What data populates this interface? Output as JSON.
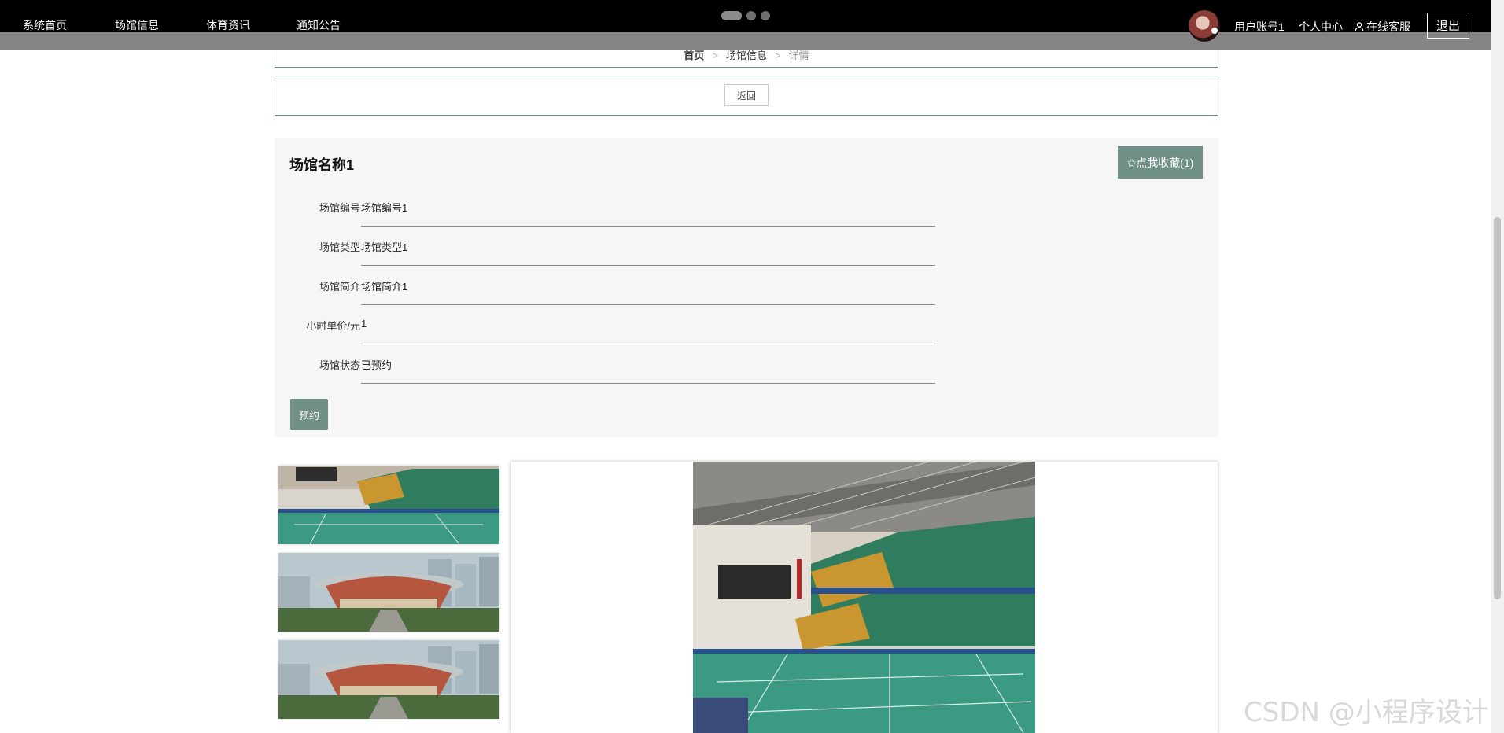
{
  "nav": {
    "links": [
      "系统首页",
      "场馆信息",
      "体育资讯",
      "通知公告"
    ],
    "user_label": "用户账号1",
    "profile_label": "个人中心",
    "service_label": "在线客服",
    "logout_label": "退出"
  },
  "breadcrumb": {
    "home": "首页",
    "section": "场馆信息",
    "current": "详情",
    "separator": ">"
  },
  "back_label": "返回",
  "venue": {
    "title": "场馆名称1",
    "favorite_label": "✩点我收藏(1)",
    "fields": [
      {
        "label": "场馆编号",
        "value": "场馆编号1"
      },
      {
        "label": "场馆类型",
        "value": "场馆类型1"
      },
      {
        "label": "场馆简介",
        "value": "场馆简介1"
      },
      {
        "label": "小时单价/元",
        "value": "1"
      },
      {
        "label": "场馆状态",
        "value": "已预约"
      }
    ],
    "book_label": "预约"
  },
  "watermark": "CSDN @小程序设计",
  "colors": {
    "accent": "#6f8f87",
    "topbar": "#000000",
    "panel": "#f6f6f6",
    "border": "#6f9490"
  }
}
